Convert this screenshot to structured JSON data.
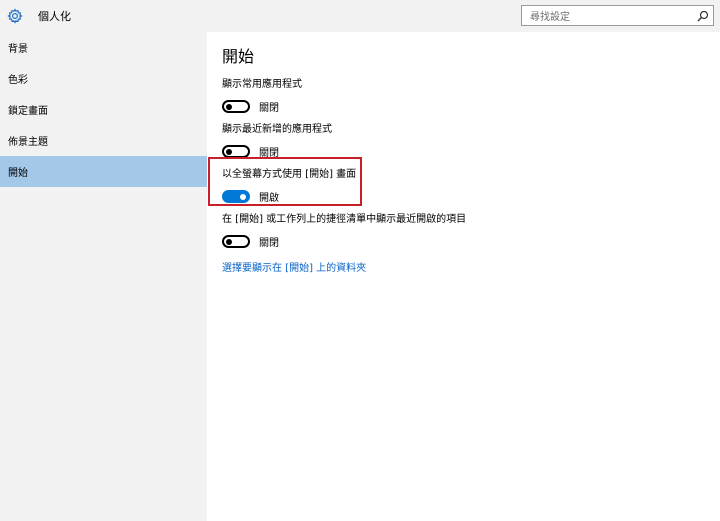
{
  "app": {
    "title": "個人化",
    "icon": "gear-icon"
  },
  "search": {
    "placeholder": "尋找設定",
    "icon": "search-icon"
  },
  "sidebar": {
    "items": [
      {
        "label": "背景"
      },
      {
        "label": "色彩"
      },
      {
        "label": "鎖定畫面"
      },
      {
        "label": "佈景主題"
      },
      {
        "label": "開始",
        "active": true
      }
    ]
  },
  "main": {
    "title": "開始",
    "settings": [
      {
        "label": "顯示常用應用程式",
        "state": "關閉",
        "on": false
      },
      {
        "label": "顯示最近新增的應用程式",
        "state": "關閉",
        "on": false
      },
      {
        "label": "以全螢幕方式使用 [開始] 畫面",
        "state": "開啟",
        "on": true
      },
      {
        "label": "在 [開始] 或工作列上的捷徑清單中顯示最近開啟的項目",
        "state": "關閉",
        "on": false
      }
    ],
    "link": "選擇要顯示在 [開始] 上的資料夾"
  },
  "colors": {
    "accent": "#0078d7",
    "sidebar_active": "#a3c8e8",
    "highlight_border": "#c8202a",
    "link": "#0a63c9"
  }
}
